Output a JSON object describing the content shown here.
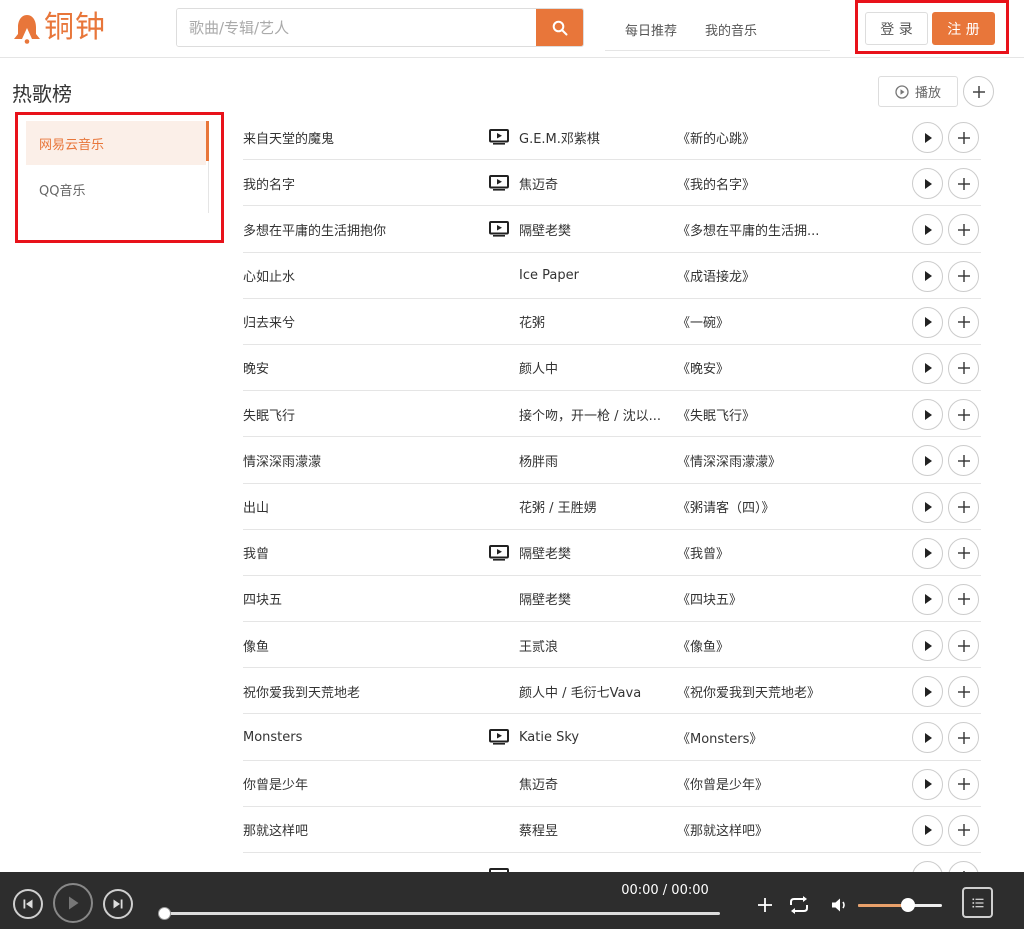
{
  "app": {
    "logo_text": "铜钟"
  },
  "search": {
    "placeholder": "歌曲/专辑/艺人"
  },
  "nav": {
    "items": [
      "每日推荐",
      "我的音乐"
    ]
  },
  "auth": {
    "login_label": "登 录",
    "register_label": "注 册"
  },
  "page": {
    "title": "热歌榜",
    "play_all_label": "播放"
  },
  "sidebar": {
    "items": [
      "网易云音乐",
      "QQ音乐"
    ],
    "active_index": 0
  },
  "songs": [
    {
      "title": "来自天堂的魔鬼",
      "mv": true,
      "artist": "G.E.M.邓紫棋",
      "album": "《新的心跳》"
    },
    {
      "title": "我的名字",
      "mv": true,
      "artist": "焦迈奇",
      "album": "《我的名字》"
    },
    {
      "title": "多想在平庸的生活拥抱你",
      "mv": true,
      "artist": "隔壁老樊",
      "album": "《多想在平庸的生活拥..."
    },
    {
      "title": "心如止水",
      "mv": false,
      "artist": "Ice Paper",
      "album": "《成语接龙》"
    },
    {
      "title": "归去来兮",
      "mv": false,
      "artist": "花粥",
      "album": "《一碗》"
    },
    {
      "title": "晚安",
      "mv": false,
      "artist": "颜人中",
      "album": "《晚安》"
    },
    {
      "title": "失眠飞行",
      "mv": false,
      "artist": "接个吻，开一枪 / 沈以...",
      "album": "《失眠飞行》"
    },
    {
      "title": "情深深雨濛濛",
      "mv": false,
      "artist": "杨胖雨",
      "album": "《情深深雨濛濛》"
    },
    {
      "title": "出山",
      "mv": false,
      "artist": "花粥 / 王胜娚",
      "album": "《粥请客（四）》"
    },
    {
      "title": "我曾",
      "mv": true,
      "artist": "隔壁老樊",
      "album": "《我曾》"
    },
    {
      "title": "四块五",
      "mv": false,
      "artist": "隔壁老樊",
      "album": "《四块五》"
    },
    {
      "title": "像鱼",
      "mv": false,
      "artist": "王贰浪",
      "album": "《像鱼》"
    },
    {
      "title": "祝你爱我到天荒地老",
      "mv": false,
      "artist": "颜人中 / 毛衍七Vava",
      "album": "《祝你爱我到天荒地老》"
    },
    {
      "title": "Monsters",
      "mv": true,
      "artist": "Katie Sky",
      "album": "《Monsters》"
    },
    {
      "title": "你曾是少年",
      "mv": false,
      "artist": "焦迈奇",
      "album": "《你曾是少年》"
    },
    {
      "title": "那就这样吧",
      "mv": false,
      "artist": "蔡程昱",
      "album": "《那就这样吧》"
    },
    {
      "title": "",
      "mv": true,
      "artist": "",
      "album": ""
    }
  ],
  "player": {
    "time": "00:00 / 00:00",
    "progress": 0,
    "volume": 0.6
  },
  "colors": {
    "accent": "#e8763a",
    "highlight_border": "#e8121a",
    "player_bg": "#2d2d2d"
  }
}
